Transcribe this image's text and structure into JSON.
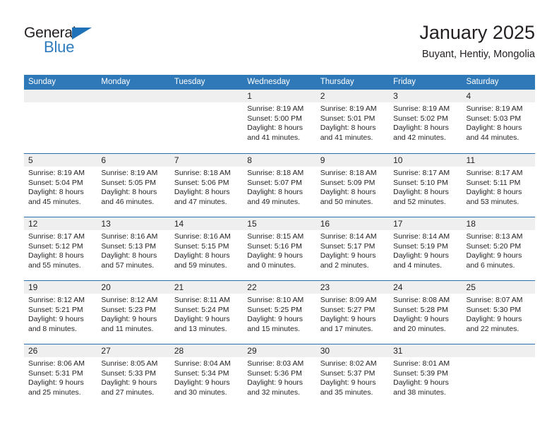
{
  "brand": {
    "name_top": "General",
    "name_bottom": "Blue",
    "triangle_icon": "triangle-icon",
    "accent_color": "#2e7cc0"
  },
  "header": {
    "title": "January 2025",
    "subtitle": "Buyant, Hentiy, Mongolia"
  },
  "colors": {
    "header_bar": "#3079b8",
    "row_divider": "#2c6fae",
    "day_strip": "#efefef",
    "text": "#231f20"
  },
  "weekdays": [
    "Sunday",
    "Monday",
    "Tuesday",
    "Wednesday",
    "Thursday",
    "Friday",
    "Saturday"
  ],
  "weeks": [
    [
      {
        "day": "",
        "lines": []
      },
      {
        "day": "",
        "lines": []
      },
      {
        "day": "",
        "lines": []
      },
      {
        "day": "1",
        "lines": [
          "Sunrise: 8:19 AM",
          "Sunset: 5:00 PM",
          "Daylight: 8 hours",
          "and 41 minutes."
        ]
      },
      {
        "day": "2",
        "lines": [
          "Sunrise: 8:19 AM",
          "Sunset: 5:01 PM",
          "Daylight: 8 hours",
          "and 41 minutes."
        ]
      },
      {
        "day": "3",
        "lines": [
          "Sunrise: 8:19 AM",
          "Sunset: 5:02 PM",
          "Daylight: 8 hours",
          "and 42 minutes."
        ]
      },
      {
        "day": "4",
        "lines": [
          "Sunrise: 8:19 AM",
          "Sunset: 5:03 PM",
          "Daylight: 8 hours",
          "and 44 minutes."
        ]
      }
    ],
    [
      {
        "day": "5",
        "lines": [
          "Sunrise: 8:19 AM",
          "Sunset: 5:04 PM",
          "Daylight: 8 hours",
          "and 45 minutes."
        ]
      },
      {
        "day": "6",
        "lines": [
          "Sunrise: 8:19 AM",
          "Sunset: 5:05 PM",
          "Daylight: 8 hours",
          "and 46 minutes."
        ]
      },
      {
        "day": "7",
        "lines": [
          "Sunrise: 8:18 AM",
          "Sunset: 5:06 PM",
          "Daylight: 8 hours",
          "and 47 minutes."
        ]
      },
      {
        "day": "8",
        "lines": [
          "Sunrise: 8:18 AM",
          "Sunset: 5:07 PM",
          "Daylight: 8 hours",
          "and 49 minutes."
        ]
      },
      {
        "day": "9",
        "lines": [
          "Sunrise: 8:18 AM",
          "Sunset: 5:09 PM",
          "Daylight: 8 hours",
          "and 50 minutes."
        ]
      },
      {
        "day": "10",
        "lines": [
          "Sunrise: 8:17 AM",
          "Sunset: 5:10 PM",
          "Daylight: 8 hours",
          "and 52 minutes."
        ]
      },
      {
        "day": "11",
        "lines": [
          "Sunrise: 8:17 AM",
          "Sunset: 5:11 PM",
          "Daylight: 8 hours",
          "and 53 minutes."
        ]
      }
    ],
    [
      {
        "day": "12",
        "lines": [
          "Sunrise: 8:17 AM",
          "Sunset: 5:12 PM",
          "Daylight: 8 hours",
          "and 55 minutes."
        ]
      },
      {
        "day": "13",
        "lines": [
          "Sunrise: 8:16 AM",
          "Sunset: 5:13 PM",
          "Daylight: 8 hours",
          "and 57 minutes."
        ]
      },
      {
        "day": "14",
        "lines": [
          "Sunrise: 8:16 AM",
          "Sunset: 5:15 PM",
          "Daylight: 8 hours",
          "and 59 minutes."
        ]
      },
      {
        "day": "15",
        "lines": [
          "Sunrise: 8:15 AM",
          "Sunset: 5:16 PM",
          "Daylight: 9 hours",
          "and 0 minutes."
        ]
      },
      {
        "day": "16",
        "lines": [
          "Sunrise: 8:14 AM",
          "Sunset: 5:17 PM",
          "Daylight: 9 hours",
          "and 2 minutes."
        ]
      },
      {
        "day": "17",
        "lines": [
          "Sunrise: 8:14 AM",
          "Sunset: 5:19 PM",
          "Daylight: 9 hours",
          "and 4 minutes."
        ]
      },
      {
        "day": "18",
        "lines": [
          "Sunrise: 8:13 AM",
          "Sunset: 5:20 PM",
          "Daylight: 9 hours",
          "and 6 minutes."
        ]
      }
    ],
    [
      {
        "day": "19",
        "lines": [
          "Sunrise: 8:12 AM",
          "Sunset: 5:21 PM",
          "Daylight: 9 hours",
          "and 8 minutes."
        ]
      },
      {
        "day": "20",
        "lines": [
          "Sunrise: 8:12 AM",
          "Sunset: 5:23 PM",
          "Daylight: 9 hours",
          "and 11 minutes."
        ]
      },
      {
        "day": "21",
        "lines": [
          "Sunrise: 8:11 AM",
          "Sunset: 5:24 PM",
          "Daylight: 9 hours",
          "and 13 minutes."
        ]
      },
      {
        "day": "22",
        "lines": [
          "Sunrise: 8:10 AM",
          "Sunset: 5:25 PM",
          "Daylight: 9 hours",
          "and 15 minutes."
        ]
      },
      {
        "day": "23",
        "lines": [
          "Sunrise: 8:09 AM",
          "Sunset: 5:27 PM",
          "Daylight: 9 hours",
          "and 17 minutes."
        ]
      },
      {
        "day": "24",
        "lines": [
          "Sunrise: 8:08 AM",
          "Sunset: 5:28 PM",
          "Daylight: 9 hours",
          "and 20 minutes."
        ]
      },
      {
        "day": "25",
        "lines": [
          "Sunrise: 8:07 AM",
          "Sunset: 5:30 PM",
          "Daylight: 9 hours",
          "and 22 minutes."
        ]
      }
    ],
    [
      {
        "day": "26",
        "lines": [
          "Sunrise: 8:06 AM",
          "Sunset: 5:31 PM",
          "Daylight: 9 hours",
          "and 25 minutes."
        ]
      },
      {
        "day": "27",
        "lines": [
          "Sunrise: 8:05 AM",
          "Sunset: 5:33 PM",
          "Daylight: 9 hours",
          "and 27 minutes."
        ]
      },
      {
        "day": "28",
        "lines": [
          "Sunrise: 8:04 AM",
          "Sunset: 5:34 PM",
          "Daylight: 9 hours",
          "and 30 minutes."
        ]
      },
      {
        "day": "29",
        "lines": [
          "Sunrise: 8:03 AM",
          "Sunset: 5:36 PM",
          "Daylight: 9 hours",
          "and 32 minutes."
        ]
      },
      {
        "day": "30",
        "lines": [
          "Sunrise: 8:02 AM",
          "Sunset: 5:37 PM",
          "Daylight: 9 hours",
          "and 35 minutes."
        ]
      },
      {
        "day": "31",
        "lines": [
          "Sunrise: 8:01 AM",
          "Sunset: 5:39 PM",
          "Daylight: 9 hours",
          "and 38 minutes."
        ]
      },
      {
        "day": "",
        "lines": []
      }
    ]
  ]
}
